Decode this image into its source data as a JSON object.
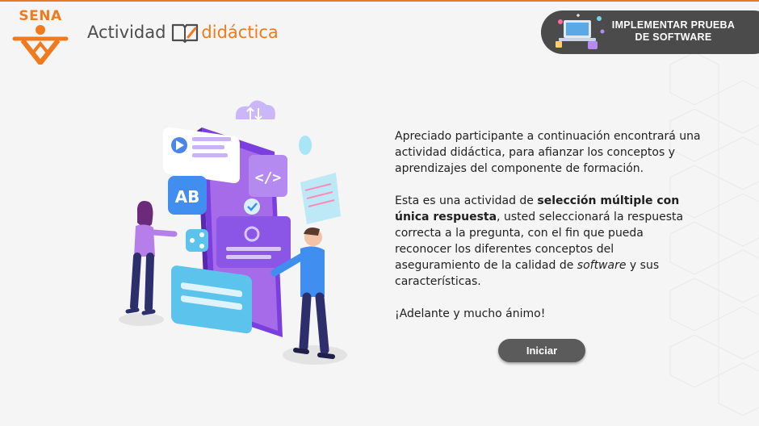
{
  "header": {
    "logo_text": "SENA",
    "title_part1": "Actividad",
    "title_part2": "didáctica",
    "module_line1": "IMPLEMENTAR PRUEBA",
    "module_line2": "DE SOFTWARE"
  },
  "intro": {
    "p1": "Apreciado participante a continuación encontrará una actividad didáctica, para afianzar los conceptos y aprendizajes del componente de formación.",
    "p2_a": "Esta es una actividad de ",
    "p2_bold": "selección múltiple con única respuesta",
    "p2_b": ", usted seleccionará la respuesta correcta a la pregunta, con el fin que pueda reconocer los diferentes conceptos del aseguramiento de la calidad de ",
    "p2_italic": "software",
    "p2_c": " y sus características.",
    "p3": "¡Adelante y mucho ánimo!"
  },
  "illustration": {
    "ab_label": "AB",
    "code_label": "</>"
  },
  "actions": {
    "start_label": "Iniciar"
  },
  "colors": {
    "accent_orange": "#f07a1e",
    "pill_dark": "#4b4b4b",
    "button_gray": "#5b5b5b",
    "purple": "#a66be8"
  }
}
